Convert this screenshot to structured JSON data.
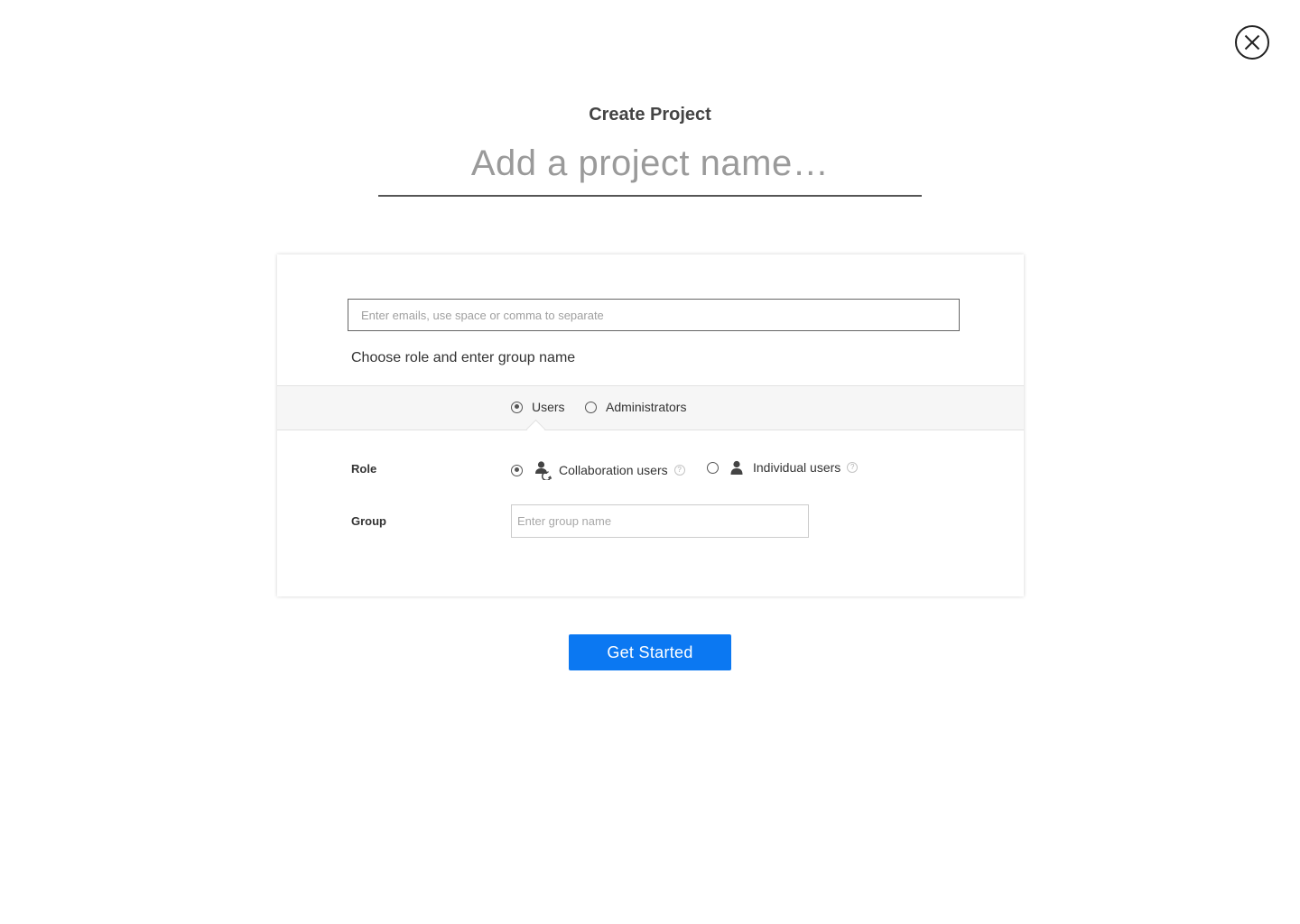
{
  "dialog": {
    "title": "Create Project",
    "project_name": {
      "value": "",
      "placeholder": "Add a project name…"
    }
  },
  "invite": {
    "email_input": {
      "value": "",
      "placeholder": "Enter emails, use space or comma to separate"
    },
    "choose_label": "Choose role and enter group name",
    "tabs": [
      {
        "label": "Users",
        "selected": true
      },
      {
        "label": "Administrators",
        "selected": false
      }
    ],
    "role": {
      "label": "Role",
      "options": [
        {
          "label": "Collaboration users",
          "icon": "collaboration-users-icon",
          "selected": true
        },
        {
          "label": "Individual users",
          "icon": "user-icon",
          "selected": false
        }
      ]
    },
    "group": {
      "label": "Group",
      "value": "",
      "placeholder": "Enter group name"
    }
  },
  "actions": {
    "get_started_label": "Get Started",
    "close_icon": "close-icon"
  },
  "colors": {
    "primary": "#0b78f2",
    "text": "#333333",
    "placeholder": "#9a9a9a",
    "tab_bar_bg": "#f6f6f6"
  }
}
